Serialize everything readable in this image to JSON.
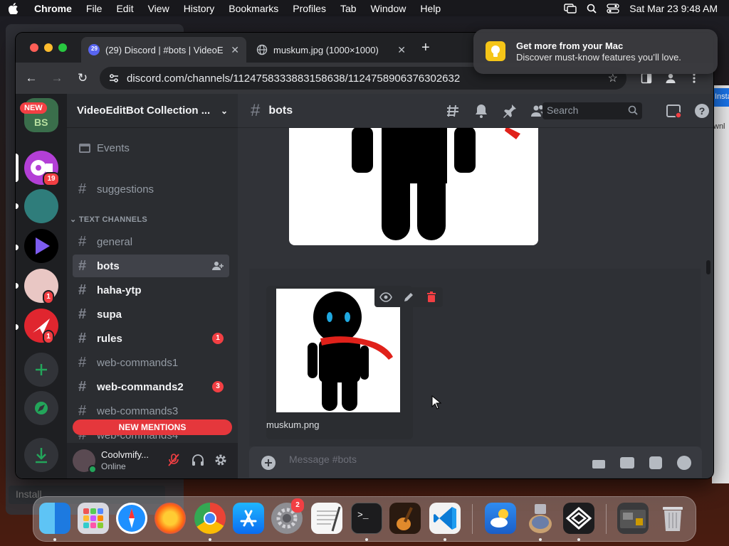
{
  "menubar": {
    "app": "Chrome",
    "items": [
      "File",
      "Edit",
      "View",
      "History",
      "Bookmarks",
      "Profiles",
      "Tab",
      "Window",
      "Help"
    ],
    "datetime": "Sat Mar 23  9:48 AM"
  },
  "notification": {
    "title": "Get more from your Mac",
    "body": "Discover must-know features you’ll love."
  },
  "browser": {
    "tabs": [
      {
        "title": "(29) Discord | #bots | VideoEd",
        "badge": "29"
      },
      {
        "title": "muskum.jpg (1000×1000)"
      }
    ],
    "url": "discord.com/channels/1124758333883158638/1124758906376302632"
  },
  "background": {
    "install_label": "Install",
    "right_button": "Insta",
    "right_text": "wnl"
  },
  "guilds": {
    "new_badge": "NEW",
    "badges": [
      "19",
      "1",
      "1"
    ]
  },
  "server": {
    "name": "VideoEditBot Collection ...",
    "events": "Events",
    "suggestions": "suggestions",
    "category": "TEXT CHANNELS",
    "channels": [
      {
        "name": "general"
      },
      {
        "name": "bots"
      },
      {
        "name": "haha-ytp"
      },
      {
        "name": "supa"
      },
      {
        "name": "rules",
        "count": "1"
      },
      {
        "name": "web-commands1"
      },
      {
        "name": "web-commands2",
        "count": "3"
      },
      {
        "name": "web-commands3"
      },
      {
        "name": "web-commands4"
      }
    ],
    "new_mentions": "NEW MENTIONS"
  },
  "user": {
    "name": "Coolvmify...",
    "status": "Online"
  },
  "chat": {
    "channel": "bots",
    "search_placeholder": "Search",
    "attachment_name": "muskum.png",
    "composer_placeholder": "Message #bots"
  },
  "colors": {
    "discord_bg": "#313338",
    "sidebar_bg": "#2b2d31",
    "guild_bg": "#1e1f22",
    "mention_red": "#f23f43",
    "scarf_red": "#e0211a"
  },
  "dock": {
    "apps": [
      "finder-icon",
      "launchpad-icon",
      "safari-icon",
      "firefox-icon",
      "chrome-icon",
      "app-store-icon",
      "system-settings-icon",
      "textedit-icon",
      "terminal-icon",
      "garageband-icon",
      "vscode-icon",
      "weather-icon",
      "preview-icon",
      "vpn-icon",
      "downloads-stack-icon",
      "trash-icon"
    ],
    "settings_badge": "2"
  }
}
